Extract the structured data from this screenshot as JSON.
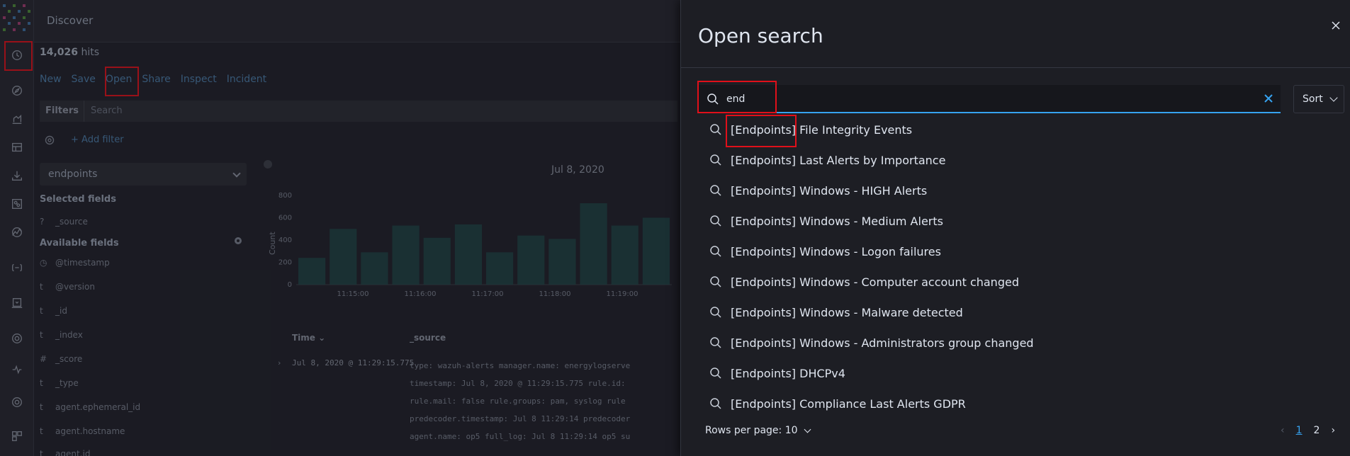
{
  "app": {
    "title": "Discover"
  },
  "hits": {
    "count": "14,026",
    "suffix": "hits"
  },
  "menu": {
    "new": "New",
    "save": "Save",
    "open": "Open",
    "share": "Share",
    "inspect": "Inspect",
    "incident": "Incident"
  },
  "filters": {
    "label": "Filters",
    "search_placeholder": "Search",
    "add_filter": "+ Add filter"
  },
  "sidebar": {
    "index_pattern": "endpoints",
    "selected_fields_title": "Selected fields",
    "selected_fields": [
      {
        "type": "?",
        "name": "_source"
      }
    ],
    "available_fields_title": "Available fields",
    "available_fields": [
      {
        "type": "◷",
        "name": "@timestamp"
      },
      {
        "type": "t",
        "name": "@version"
      },
      {
        "type": "t",
        "name": "_id"
      },
      {
        "type": "t",
        "name": "_index"
      },
      {
        "type": "#",
        "name": "_score"
      },
      {
        "type": "t",
        "name": "_type"
      },
      {
        "type": "t",
        "name": "agent.ephemeral_id"
      },
      {
        "type": "t",
        "name": "agent.hostname"
      },
      {
        "type": "t",
        "name": "agent.id"
      }
    ]
  },
  "histogram": {
    "date_label": "Jul 8, 2020",
    "ylabel": "Count"
  },
  "chart_data": {
    "type": "bar",
    "ylabel": "Count",
    "ylim": [
      0,
      800
    ],
    "yticks": [
      0,
      200,
      400,
      600,
      800
    ],
    "xticks": [
      "11:15:00",
      "11:16:00",
      "11:17:00",
      "11:18:00",
      "11:19:00"
    ],
    "values": [
      240,
      500,
      290,
      530,
      420,
      540,
      290,
      440,
      410,
      730,
      530,
      600
    ]
  },
  "table": {
    "time_header": "Time",
    "source_header": "_source",
    "row_time": "Jul 8, 2020 @ 11:29:15.775",
    "source_lines": [
      "type: wazuh-alerts  manager.name: energylogserve",
      "timestamp: Jul 8, 2020 @ 11:29:15.775  rule.id:",
      "rule.mail: false  rule.groups: pam, syslog  rule",
      "predecoder.timestamp: Jul 8 11:29:14  predecoder",
      "agent.name: op5  full_log: Jul 8 11:29:14 op5 su"
    ]
  },
  "flyout": {
    "title": "Open search",
    "search_value": "end",
    "sort_label": "Sort",
    "results": [
      {
        "prefix": "[Endpoints]",
        "rest": " File Integrity Events"
      },
      {
        "prefix": "[Endpoints]",
        "rest": " Last Alerts by Importance"
      },
      {
        "prefix": "[Endpoints]",
        "rest": " Windows - HIGH Alerts"
      },
      {
        "prefix": "[Endpoints]",
        "rest": " Windows - Medium Alerts"
      },
      {
        "prefix": "[Endpoints]",
        "rest": " Windows - Logon failures"
      },
      {
        "prefix": "[Endpoints]",
        "rest": " Windows - Computer account changed"
      },
      {
        "prefix": "[Endpoints]",
        "rest": " Windows - Malware detected"
      },
      {
        "prefix": "[Endpoints]",
        "rest": " Windows - Administrators group changed"
      },
      {
        "prefix": "[Endpoints]",
        "rest": " DHCPv4"
      },
      {
        "prefix": "[Endpoints]",
        "rest": " Compliance Last Alerts GDPR"
      }
    ],
    "rows_per_page": "Rows per page: 10",
    "pages": [
      "1",
      "2"
    ],
    "current_page": "1"
  },
  "colors": {
    "accent": "#36a2ef",
    "highlight": "#e0101a",
    "bars": "#1f4a4a"
  }
}
